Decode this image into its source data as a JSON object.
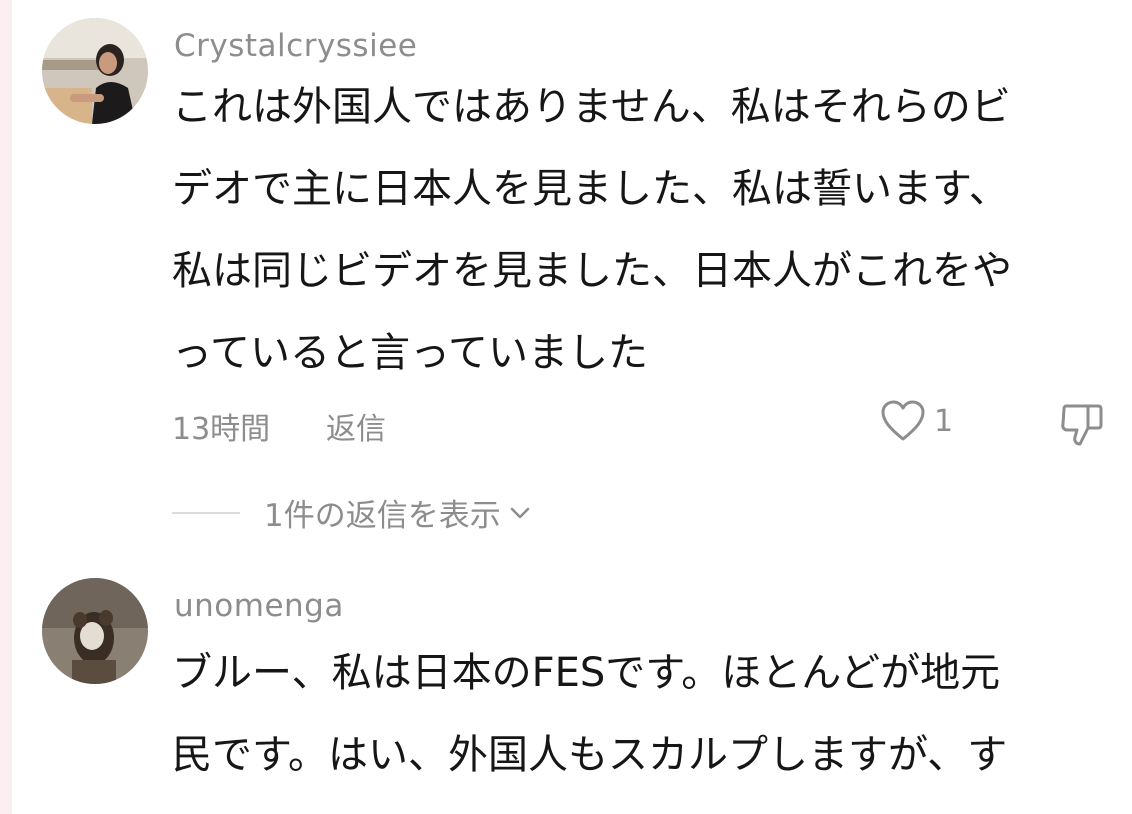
{
  "comments": [
    {
      "username": "Crystalcryssiee",
      "body_lines": [
        "これは外国人ではありません、私はそれらのビ",
        "デオで主に日本人を見ました、私は誓います、",
        "私は同じビデオを見ました、日本人がこれをや",
        "っていると言っていました"
      ],
      "time": "13時間",
      "reply_label": "返信",
      "like_count": "1",
      "view_replies_label": "1件の返信を表示",
      "avatar_icon": "user-photo-avatar"
    },
    {
      "username": "unomenga",
      "body_lines": [
        "ブルー、私は日本のFESです。ほとんどが地元",
        "民です。はい、外国人もスカルプしますが、す"
      ],
      "avatar_icon": "user-photo-avatar"
    }
  ],
  "icons": {
    "like": "heart-outline-icon",
    "dislike": "thumbs-down-outline-icon",
    "expand": "chevron-down-icon"
  },
  "colors": {
    "text": "#161616",
    "muted": "#8d8d8d",
    "edge": "#fbeff1"
  }
}
